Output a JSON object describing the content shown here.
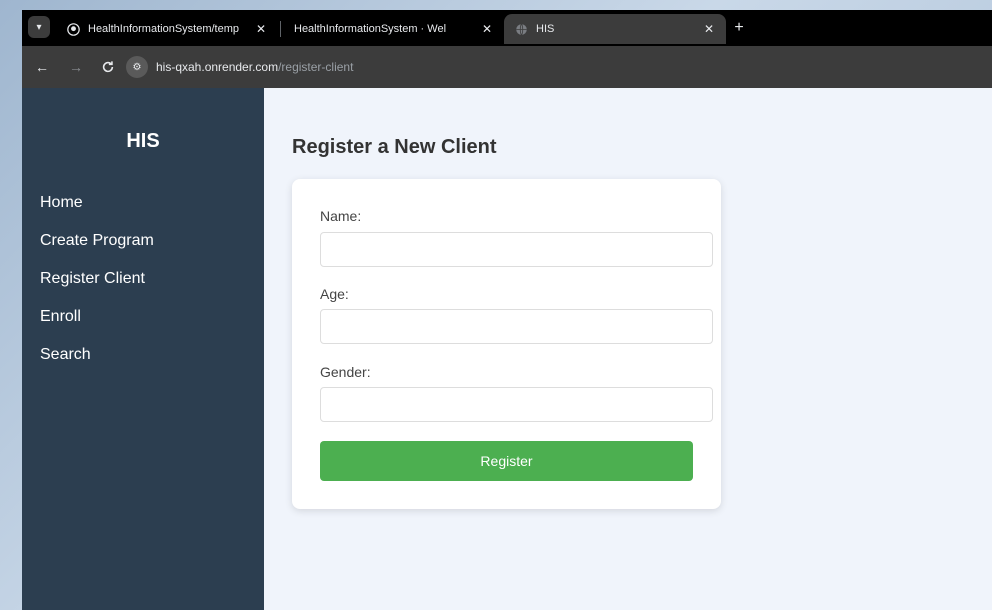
{
  "browser": {
    "tabs": [
      {
        "title": "HealthInformationSystem/temp",
        "close": "✕",
        "icon": "github-icon"
      },
      {
        "title": "HealthInformationSystem · Wel",
        "close": "✕",
        "icon": ""
      },
      {
        "title": "HIS",
        "close": "✕",
        "icon": "globe-icon"
      }
    ],
    "new_tab": "+",
    "url_host": "his-qxah.onrender.com",
    "url_path": "/register-client"
  },
  "sidebar": {
    "brand": "HIS",
    "items": [
      {
        "label": "Home"
      },
      {
        "label": "Create Program"
      },
      {
        "label": "Register Client"
      },
      {
        "label": "Enroll"
      },
      {
        "label": "Search"
      }
    ]
  },
  "main": {
    "title": "Register a New Client",
    "form": {
      "name_label": "Name:",
      "name_value": "",
      "age_label": "Age:",
      "age_value": "",
      "gender_label": "Gender:",
      "gender_value": "",
      "submit_label": "Register"
    }
  },
  "colors": {
    "sidebar_bg": "#2c3e50",
    "page_bg": "#f0f4fb",
    "button_bg": "#4caf50"
  }
}
